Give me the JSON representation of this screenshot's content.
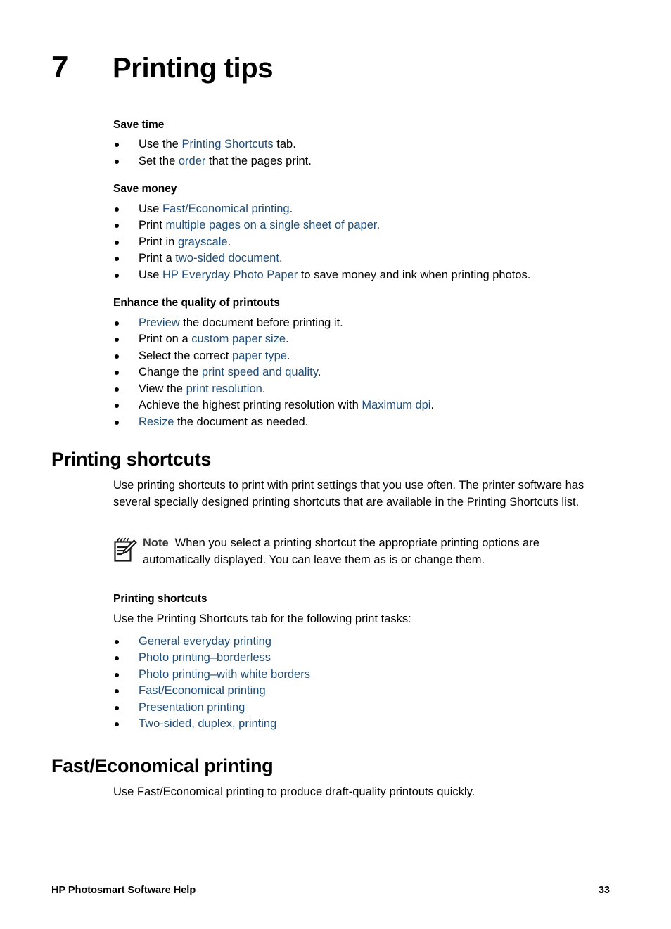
{
  "page": {
    "chapter_number": "7",
    "chapter_title": "Printing tips",
    "footer_left": "HP Photosmart Software Help",
    "footer_page_number": "33",
    "link_color": "#1f4e79"
  },
  "save_time": {
    "heading": "Save time",
    "items": [
      {
        "pre": "Use the ",
        "link": "Printing Shortcuts",
        "post": " tab."
      },
      {
        "pre": "Set the ",
        "link": "order",
        "post": " that the pages print."
      }
    ]
  },
  "save_money": {
    "heading": "Save money",
    "items": [
      {
        "pre": "Use ",
        "link": "Fast/Economical printing",
        "post": "."
      },
      {
        "pre": "Print ",
        "link": "multiple pages on a single sheet of paper",
        "post": "."
      },
      {
        "pre": "Print in ",
        "link": "grayscale",
        "post": "."
      },
      {
        "pre": "Print a ",
        "link": "two-sided document",
        "post": "."
      },
      {
        "pre": "Use ",
        "link": "HP Everyday Photo Paper",
        "post": " to save money and ink when printing photos."
      }
    ]
  },
  "enhance_quality": {
    "heading": "Enhance the quality of printouts",
    "items": [
      {
        "pre": "",
        "link": "Preview",
        "post": " the document before printing it."
      },
      {
        "pre": "Print on a ",
        "link": "custom paper size",
        "post": "."
      },
      {
        "pre": "Select the correct ",
        "link": "paper type",
        "post": "."
      },
      {
        "pre": "Change the ",
        "link": "print speed and quality",
        "post": "."
      },
      {
        "pre": "View the ",
        "link": "print resolution",
        "post": "."
      },
      {
        "pre": "Achieve the highest printing resolution with ",
        "link": "Maximum dpi",
        "post": "."
      },
      {
        "pre": "",
        "link": "Resize",
        "post": " the document as needed."
      }
    ]
  },
  "printing_shortcuts_section": {
    "heading": "Printing shortcuts",
    "intro": "Use printing shortcuts to print with print settings that you use often. The printer software has several specially designed printing shortcuts that are available in the Printing Shortcuts list.",
    "note": {
      "icon": "note-pad-pencil-icon",
      "label": "Note",
      "text": "When you select a printing shortcut the appropriate printing options are automatically displayed. You can leave them as is or change them."
    },
    "subheading": "Printing shortcuts",
    "sub_intro": "Use the Printing Shortcuts tab for the following print tasks:",
    "task_links": [
      "General everyday printing",
      "Photo printing–borderless",
      "Photo printing–with white borders",
      "Fast/Economical printing",
      "Presentation printing",
      "Two-sided, duplex, printing"
    ]
  },
  "fast_economical_section": {
    "heading": "Fast/Economical printing",
    "intro": "Use Fast/Economical printing to produce draft-quality printouts quickly."
  }
}
